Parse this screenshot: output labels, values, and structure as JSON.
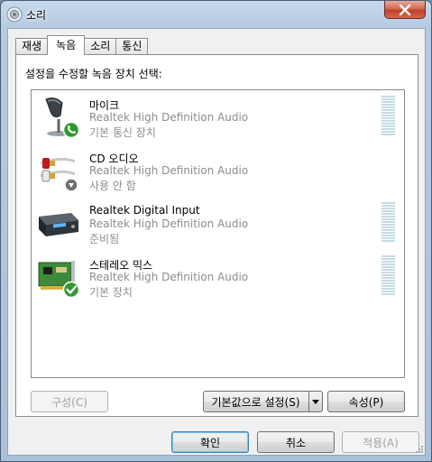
{
  "window": {
    "title": "소리",
    "close_icon": "close-icon"
  },
  "tabs": [
    {
      "label": "재생",
      "active": false
    },
    {
      "label": "녹음",
      "active": true
    },
    {
      "label": "소리",
      "active": false
    },
    {
      "label": "통신",
      "active": false
    }
  ],
  "panel": {
    "instruction": "설정을 수정할 녹음 장치 선택:"
  },
  "devices": [
    {
      "name": "마이크",
      "driver": "Realtek High Definition Audio",
      "status": "기본 통신 장치",
      "icon": "microphone-icon",
      "badge": "phone-badge-icon",
      "level_meter": true
    },
    {
      "name": "CD 오디오",
      "driver": "Realtek High Definition Audio",
      "status": "사용 안 함",
      "icon": "rca-cable-icon",
      "badge": "disabled-badge-icon",
      "level_meter": false
    },
    {
      "name": "Realtek Digital Input",
      "driver": "Realtek High Definition Audio",
      "status": "준비됨",
      "icon": "digital-input-device-icon",
      "badge": "",
      "level_meter": true
    },
    {
      "name": "스테레오 믹스",
      "driver": "Realtek High Definition Audio",
      "status": "기본 장치",
      "icon": "sound-card-icon",
      "badge": "check-badge-icon",
      "level_meter": true
    }
  ],
  "buttons": {
    "configure": "구성(C)",
    "set_default": "기본값으로 설정(S)",
    "properties": "속성(P)",
    "ok": "확인",
    "cancel": "취소",
    "apply": "적용(A)"
  },
  "colors": {
    "titlebar": "#b5cbe2",
    "close_button": "#c1402a",
    "disabled_text": "#8d8d8d",
    "level_meter": "#c6dbe3",
    "badge_green": "#2e9a2e"
  }
}
